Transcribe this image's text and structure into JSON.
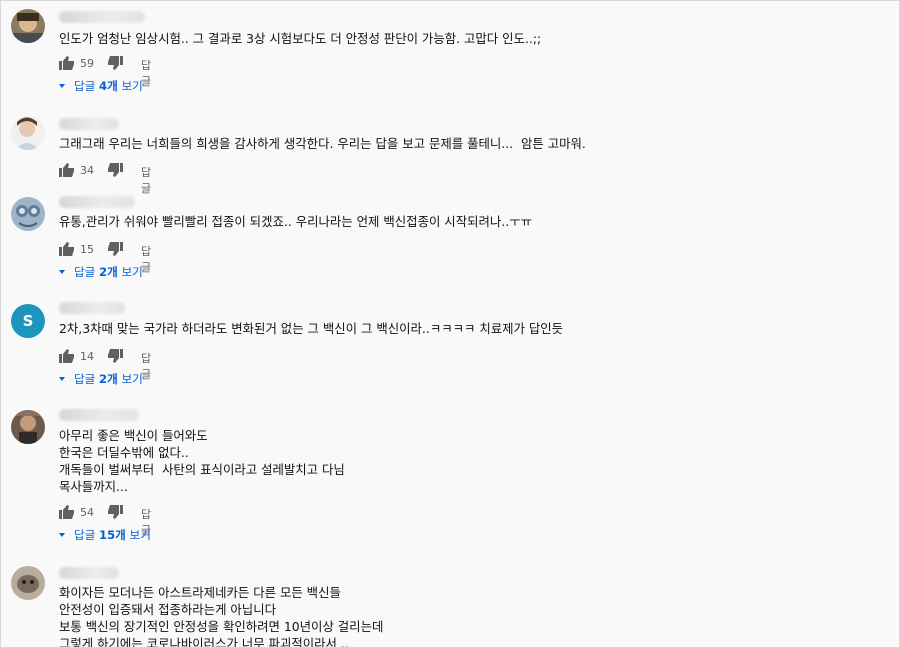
{
  "comments": [
    {
      "text": "인도가 엄청난 임상시험.. 그 결과로 3상 시험보다도 더 안정성 판단이 가능함. 고맙다 인도..;;",
      "likes": "59",
      "reply_label": "답글",
      "replies_pre": "답글 ",
      "replies_count": "4개",
      "replies_post": " 보기"
    },
    {
      "text": "그래그래 우리는 너희들의 희생을 감사하게 생각한다. 우리는 답을 보고 문제를 풀테니...  암튼 고마워.",
      "likes": "34",
      "reply_label": "답글"
    },
    {
      "text": "유통,관리가 쉬워야 빨리빨리 접종이 되겠죠.. 우리나라는 언제 백신접종이 시작되려나..ㅜㅠ",
      "likes": "15",
      "reply_label": "답글",
      "replies_pre": "답글 ",
      "replies_count": "2개",
      "replies_post": " 보기"
    },
    {
      "avatar_letter": "S",
      "text": "2차,3차때 맞는 국가라 하더라도 변화된거 없는 그 백신이 그 백신이라..ㅋㅋㅋㅋ 치료제가 답인듯",
      "likes": "14",
      "reply_label": "답글",
      "replies_pre": "답글 ",
      "replies_count": "2개",
      "replies_post": " 보기"
    },
    {
      "text": "아무리 좋은 백신이 들어와도\n한국은 더딜수밖에 없다..\n개독들이 벌써부터  사탄의 표식이라고 설레발치고 다님\n목사들까지...",
      "likes": "54",
      "reply_label": "답글",
      "replies_pre": "답글 ",
      "replies_count": "15개",
      "replies_post": " 보기"
    },
    {
      "text": "화이자든 모더나든 아스트라제네카든 다른 모든 백신들\n안전성이 입증돼서 접종하라는게 아닙니다\n보통 백신의 장기적인 안정성을 확인하려면 10년이상 걸리는데\n그렇게 하기에는 코로나바이러스가 너무 파괴적이라서 .."
    }
  ],
  "colors": {
    "link": "#065fd4",
    "muted": "#606060",
    "avatar_s": "#1e95bd"
  },
  "icons": [
    "thumbs-up-icon",
    "thumbs-down-icon",
    "caret-down-icon"
  ]
}
